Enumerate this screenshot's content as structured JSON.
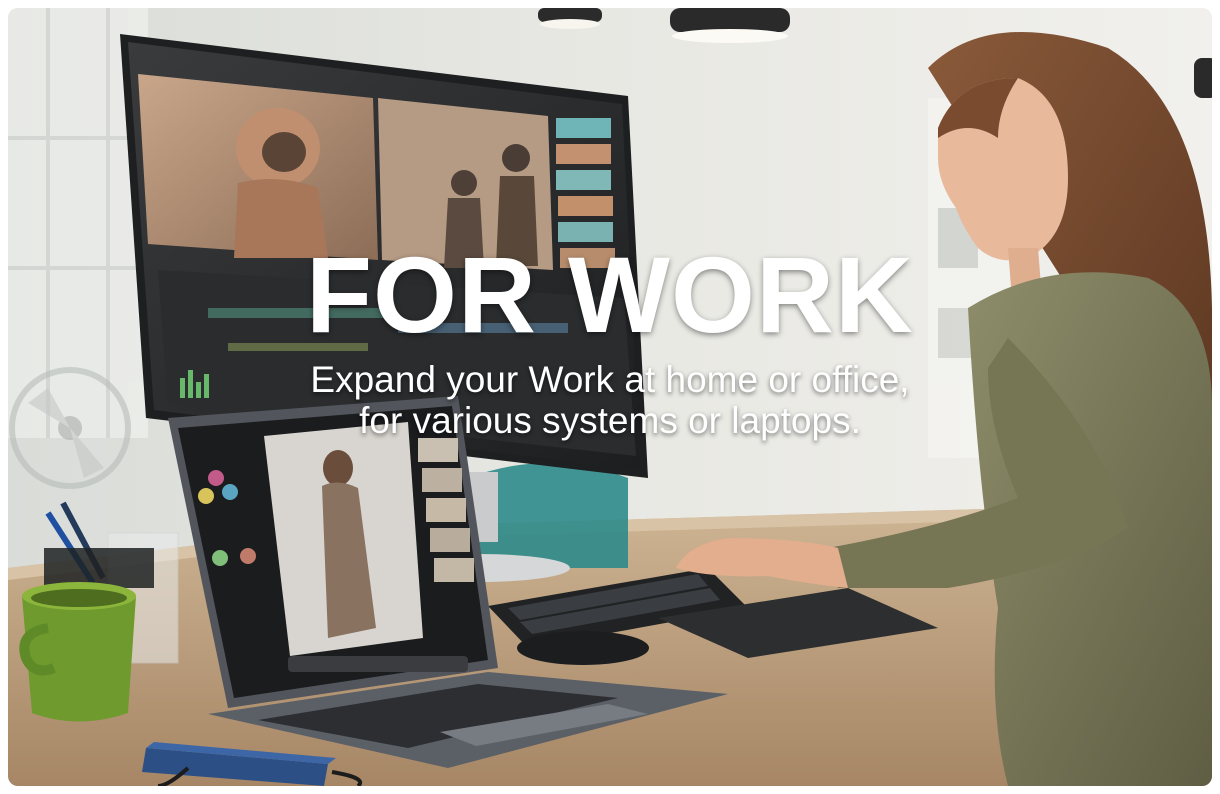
{
  "banner": {
    "headline": "FOR WORK",
    "subline_1": "Expand your Work at home or office,",
    "subline_2": "for various systems or laptops."
  },
  "scene": {
    "description_colors": {
      "wall": "#e6e7e3",
      "desk": "#b99d7c",
      "monitor_frame": "#2a2c2f",
      "laptop_body": "#5b5f66",
      "mug": "#6f9a2e",
      "shirt": "#7a7a5a",
      "hub": "#2c4f86"
    },
    "icons": [
      "monitor-icon",
      "laptop-icon",
      "keyboard-icon",
      "mouse-icon",
      "mug-icon",
      "usb-hub-icon"
    ]
  }
}
